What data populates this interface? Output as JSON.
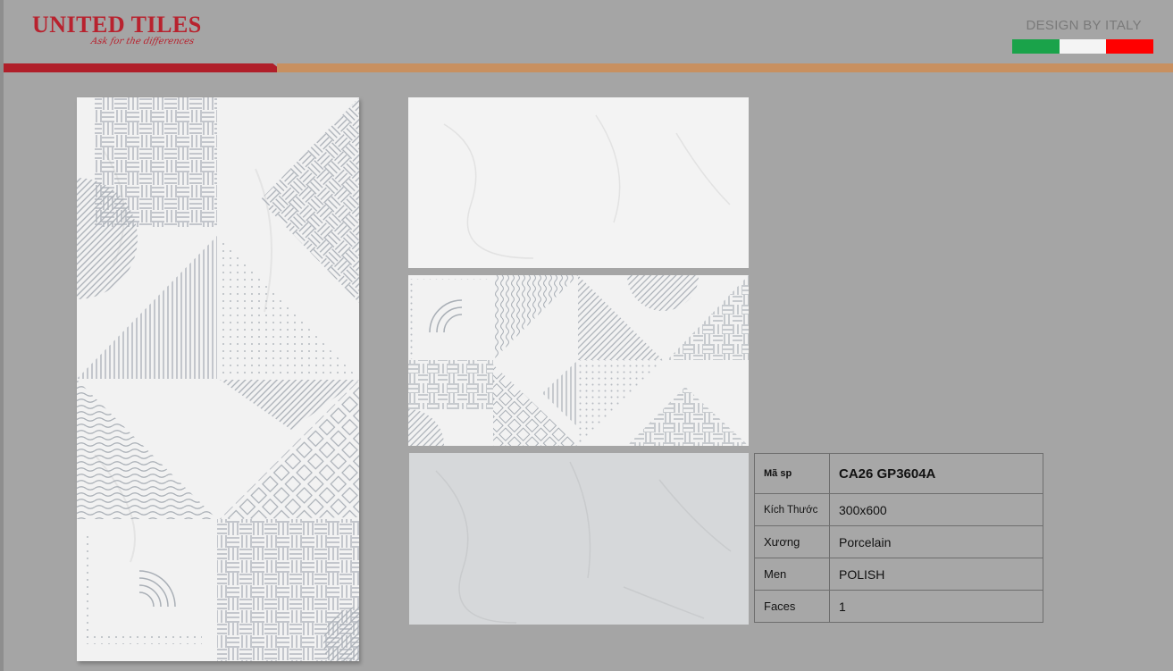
{
  "header": {
    "brand_name": "UNITED TILES",
    "brand_tagline": "Ask for the differences",
    "design_label": "DESIGN BY ITALY",
    "flag_colors": [
      "#1aa34a",
      "#f4f4f4",
      "#ff0000"
    ]
  },
  "colors": {
    "background": "#a5a5a5",
    "brand_red": "#b8222e",
    "stripe_tan": "#c89060"
  },
  "spec_table": {
    "rows": [
      {
        "label": "Mã sp",
        "value": "CA26 GP3604A"
      },
      {
        "label": "Kích Thước",
        "value": "300x600"
      },
      {
        "label": "Xương",
        "value": "Porcelain"
      },
      {
        "label": "Men",
        "value": "POLISH"
      },
      {
        "label": "Faces",
        "value": "1"
      }
    ]
  }
}
